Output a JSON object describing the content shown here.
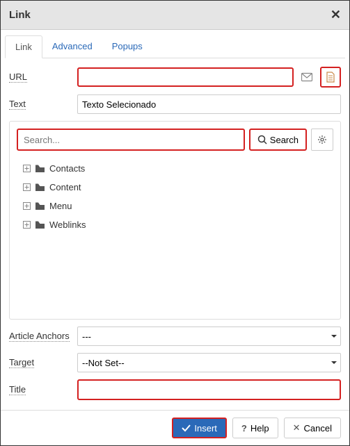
{
  "header": {
    "title": "Link"
  },
  "tabs": {
    "link": "Link",
    "advanced": "Advanced",
    "popups": "Popups"
  },
  "form": {
    "url_label": "URL",
    "url_value": "",
    "text_label": "Text",
    "text_value": "Texto Selecionado",
    "anchors_label": "Article Anchors",
    "anchors_value": "---",
    "target_label": "Target",
    "target_value": "--Not Set--",
    "title_label": "Title",
    "title_value": ""
  },
  "browser": {
    "search_placeholder": "Search...",
    "search_label": "Search",
    "items": [
      "Contacts",
      "Content",
      "Menu",
      "Weblinks"
    ]
  },
  "footer": {
    "insert": "Insert",
    "help": "Help",
    "cancel": "Cancel"
  }
}
